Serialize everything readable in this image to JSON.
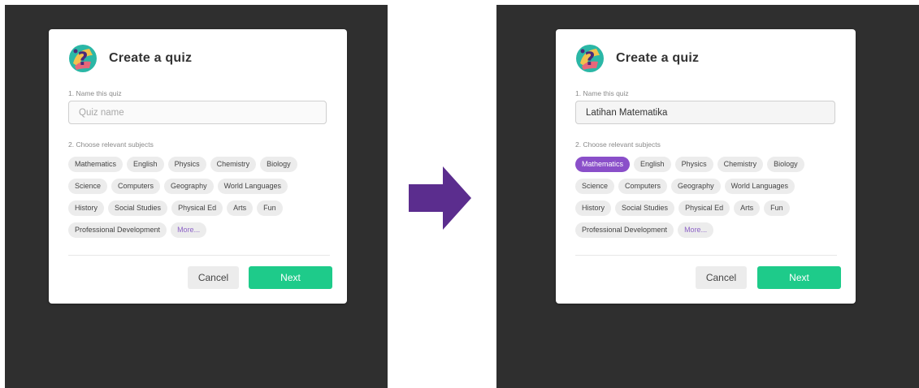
{
  "colors": {
    "backdrop": "#2f2f2f",
    "arrow": "#5b2d8e",
    "selected_chip": "#8a4fc9",
    "next_button": "#1ecb8a",
    "more_link": "#8c62c6"
  },
  "left": {
    "title": "Create a quiz",
    "step1_label": "1. Name this quiz",
    "input_value": "",
    "input_placeholder": "Quiz name",
    "step2_label": "2. Choose relevant subjects",
    "subjects": [
      "Mathematics",
      "English",
      "Physics",
      "Chemistry",
      "Biology",
      "Science",
      "Computers",
      "Geography",
      "World Languages",
      "History",
      "Social Studies",
      "Physical Ed",
      "Arts",
      "Fun",
      "Professional Development"
    ],
    "selected_subject": "",
    "more_label": "More...",
    "cancel_label": "Cancel",
    "next_label": "Next"
  },
  "right": {
    "title": "Create a quiz",
    "step1_label": "1. Name this quiz",
    "input_value": "Latihan Matematika",
    "input_placeholder": "Quiz name",
    "step2_label": "2. Choose relevant subjects",
    "subjects": [
      "Mathematics",
      "English",
      "Physics",
      "Chemistry",
      "Biology",
      "Science",
      "Computers",
      "Geography",
      "World Languages",
      "History",
      "Social Studies",
      "Physical Ed",
      "Arts",
      "Fun",
      "Professional Development"
    ],
    "selected_subject": "Mathematics",
    "more_label": "More...",
    "cancel_label": "Cancel",
    "next_label": "Next"
  },
  "arrow_icon": "right-arrow-icon",
  "logo_icon": "quiz-logo-icon"
}
